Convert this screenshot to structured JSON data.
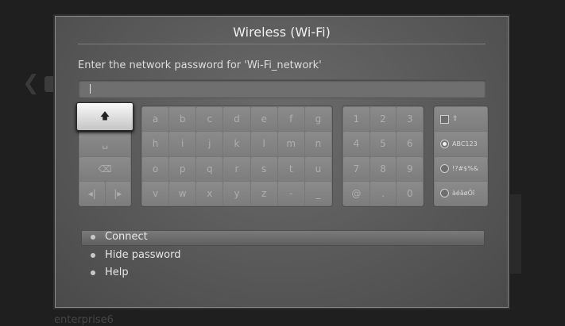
{
  "background": {
    "back_glyph": "❮",
    "list_item": "enterprise6"
  },
  "dialog": {
    "title": "Wireless (Wi-Fi)",
    "prompt": "Enter the network password for 'Wi-Fi_network'",
    "password_value": ""
  },
  "keyboard": {
    "function_keys": {
      "shift": "🡅",
      "space": "␣",
      "backspace": "⌫",
      "cursor_left": "◂|",
      "cursor_right": "|▸"
    },
    "letter_rows": [
      [
        "a",
        "b",
        "c",
        "d",
        "e",
        "f",
        "g"
      ],
      [
        "h",
        "i",
        "j",
        "k",
        "l",
        "m",
        "n"
      ],
      [
        "o",
        "p",
        "q",
        "r",
        "s",
        "t",
        "u"
      ],
      [
        "v",
        "w",
        "x",
        "y",
        "z",
        "-",
        "_"
      ]
    ],
    "number_rows": [
      [
        "1",
        "2",
        "3"
      ],
      [
        "4",
        "5",
        "6"
      ],
      [
        "7",
        "8",
        "9"
      ],
      [
        "@",
        ".",
        "0"
      ]
    ],
    "modes": {
      "shift_label": "⇧",
      "abc": "ABC123",
      "symbols": "!?#$%&",
      "accents": "àéâøÖî",
      "selected": "abc"
    }
  },
  "menu": {
    "connect": "Connect",
    "hide_password": "Hide password",
    "help": "Help"
  },
  "colors": {
    "dialog_bg": "#5c5c5c",
    "selected_key": "#f0f0f0",
    "screen_bg": "#1f1f1f"
  }
}
